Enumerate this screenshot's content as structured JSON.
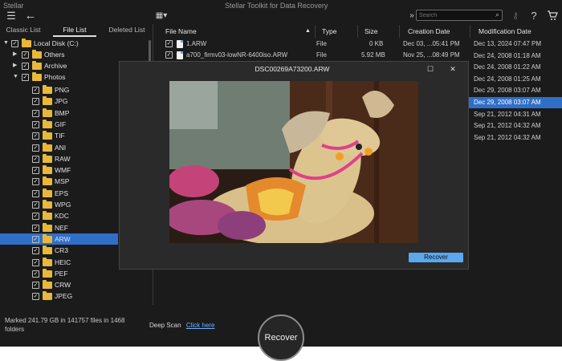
{
  "app": {
    "brand": "Stellar",
    "title": "Stellar Toolkit for Data Recovery"
  },
  "toolbar": {
    "search_placeholder": "Search",
    "icons": [
      "menu-icon",
      "back-icon",
      "grid-view-icon",
      "expand-icon",
      "search-icon",
      "key-icon",
      "help-icon",
      "cart-icon"
    ]
  },
  "tabs": [
    "Classic List",
    "File List",
    "Deleted List"
  ],
  "tree": {
    "root": "Local Disk (C:)",
    "top_items": [
      "Others",
      "Archive",
      "Photos"
    ],
    "photo_types": [
      "PNG",
      "JPG",
      "BMP",
      "GIF",
      "TIF",
      "ANI",
      "RAW",
      "WMF",
      "MSP",
      "EPS",
      "WPG",
      "KDC",
      "NEF",
      "ARW",
      "CR3",
      "HEIC",
      "PEF",
      "CRW",
      "JPEG"
    ],
    "selected": "ARW"
  },
  "table": {
    "headers": [
      "File Name",
      "Type",
      "Size",
      "Creation Date",
      "Modification Date"
    ],
    "rows": [
      {
        "name": "1.ARW",
        "type": "File",
        "size": "0 KB",
        "created": "Dec 03, ...05:41 PM"
      },
      {
        "name": "a700_firmv03-lowNR-6400iso.ARW",
        "type": "File",
        "size": "5.92 MB",
        "created": "Nov 25, ...08:49 PM"
      }
    ],
    "modification_dates": [
      "Dec 13, 2024 07:47 PM",
      "Dec 24, 2008 01:18 AM",
      "Dec 24, 2008 01:22 AM",
      "Dec 24, 2008 01:25 AM",
      "Dec 29, 2008 03:07 AM",
      "Dec 29, 2008 03:07 AM",
      "Sep 21, 2012 04:31 AM",
      "Sep 21, 2012 04:32 AM",
      "Sep 21, 2012 04:32 AM"
    ],
    "selected_mod_index": 5
  },
  "preview": {
    "title": "DSC00269A73200.ARW",
    "recover_label": "Recover"
  },
  "footer": {
    "status": "Marked 241.79 GB in 141757 files in 1468 folders",
    "deep_scan_label": "Deep Scan",
    "deep_scan_link": "Click here",
    "recover_label": "Recover"
  },
  "colors": {
    "background": "#1b1b1b",
    "selection": "#2f6fc8",
    "accent_button": "#5aa8ee",
    "folder": "#e8b83a",
    "link": "#6fb2ff"
  }
}
